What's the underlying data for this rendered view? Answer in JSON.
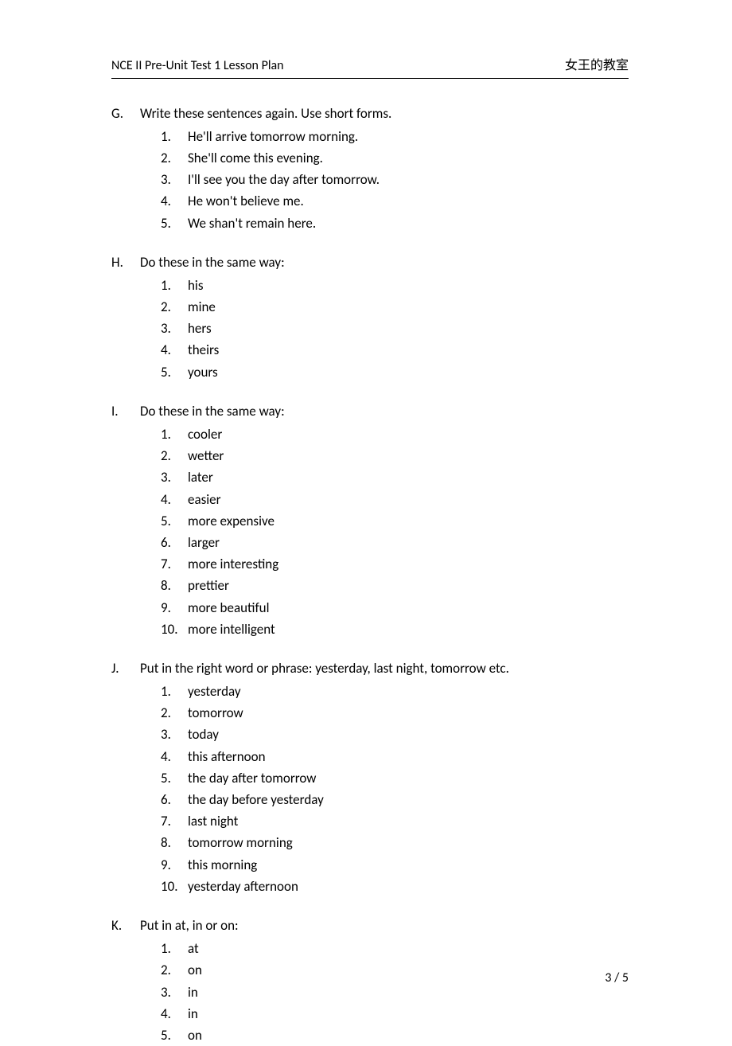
{
  "header": {
    "left": "NCE II Pre-Unit Test 1 Lesson Plan",
    "right": "女王的教室"
  },
  "sections": [
    {
      "letter": "G.",
      "prompt": "Write these sentences again. Use short forms.",
      "items": [
        "He'll arrive tomorrow morning.",
        "She'll come this evening.",
        "I'll see you the day after tomorrow.",
        "He won't believe me.",
        "We shan't remain here."
      ]
    },
    {
      "letter": "H.",
      "prompt": "Do these in the same way:",
      "items": [
        "his",
        "mine",
        "hers",
        "theirs",
        "yours"
      ]
    },
    {
      "letter": "I.",
      "prompt": "Do these in the same way:",
      "items": [
        "cooler",
        "wetter",
        "later",
        "easier",
        "more expensive",
        "larger",
        "more interesting",
        "prettier",
        "more beautiful",
        "more intelligent"
      ]
    },
    {
      "letter": "J.",
      "prompt": "Put in the right word or phrase: yesterday, last night, tomorrow etc.",
      "items": [
        "yesterday",
        "tomorrow",
        "today",
        "this afternoon",
        "the day after tomorrow",
        "the day before yesterday",
        "last night",
        "tomorrow morning",
        "this morning",
        "yesterday afternoon"
      ]
    },
    {
      "letter": "K.",
      "prompt": "Put in at, in or on:",
      "items": [
        "at",
        "on",
        "in",
        "in",
        "on"
      ]
    }
  ],
  "page_number": "3 / 5"
}
